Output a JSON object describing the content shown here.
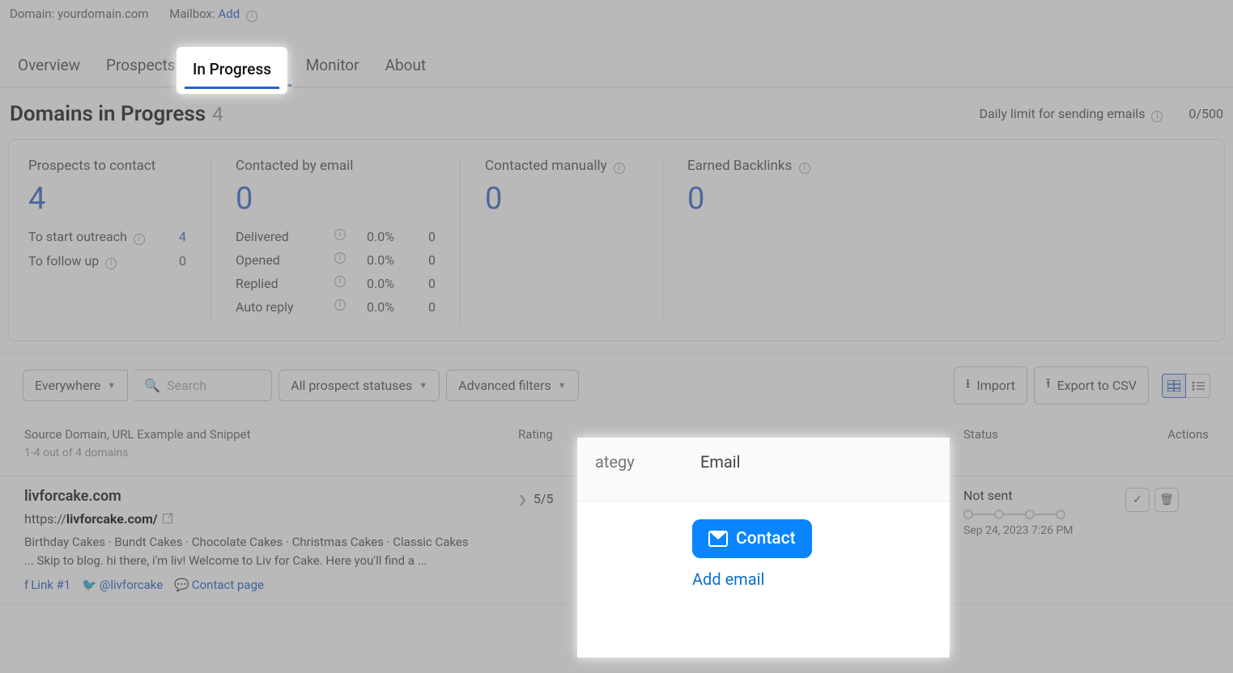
{
  "topbar": {
    "domain_label": "Domain:",
    "domain_value": "yourdomain.com",
    "mailbox_label": "Mailbox:",
    "mailbox_action": "Add"
  },
  "tabs": [
    "Overview",
    "Prospects",
    "In Progress",
    "Monitor",
    "About"
  ],
  "active_tab": "In Progress",
  "page": {
    "title": "Domains in Progress",
    "count": "4",
    "limit_label": "Daily limit for sending emails",
    "limit_value": "0/500"
  },
  "metrics": {
    "prospects": {
      "label": "Prospects to contact",
      "value": "4",
      "rows": [
        {
          "label": "To start outreach",
          "value": "4",
          "linked": true
        },
        {
          "label": "To follow up",
          "value": "0",
          "linked": false
        }
      ]
    },
    "email": {
      "label": "Contacted by email",
      "value": "0",
      "rows": [
        {
          "label": "Delivered",
          "pct": "0.0%",
          "n": "0"
        },
        {
          "label": "Opened",
          "pct": "0.0%",
          "n": "0"
        },
        {
          "label": "Replied",
          "pct": "0.0%",
          "n": "0"
        },
        {
          "label": "Auto reply",
          "pct": "0.0%",
          "n": "0"
        }
      ]
    },
    "manual": {
      "label": "Contacted manually",
      "value": "0"
    },
    "backlinks": {
      "label": "Earned Backlinks",
      "value": "0"
    }
  },
  "filters": {
    "scope": "Everywhere",
    "search_placeholder": "Search",
    "status": "All prospect statuses",
    "advanced": "Advanced filters",
    "import": "Import",
    "export": "Export to CSV"
  },
  "table": {
    "headers": {
      "source": "Source Domain, URL Example and Snippet",
      "hint": "1-4 out of 4 domains",
      "rating": "Rating",
      "strategy": "ategy",
      "email": "Email",
      "status": "Status",
      "actions": "Actions"
    },
    "row": {
      "domain": "livforcake.com",
      "url_prefix": "https://",
      "url_bold": "livforcake.com/",
      "snippet": "Birthday Cakes · Bundt Cakes · Chocolate Cakes · Christmas Cakes · Classic Cakes ... Skip to blog. hi there, i'm liv! Welcome to Liv for Cake. Here you'll find a ...",
      "link1": "Link #1",
      "twitter": "@livforcake",
      "contact_page": "Contact page",
      "rating": "5/5",
      "contact_btn": "Contact",
      "add_email": "Add email",
      "status": "Not sent",
      "timestamp": "Sep 24, 2023 7:26 PM"
    }
  }
}
